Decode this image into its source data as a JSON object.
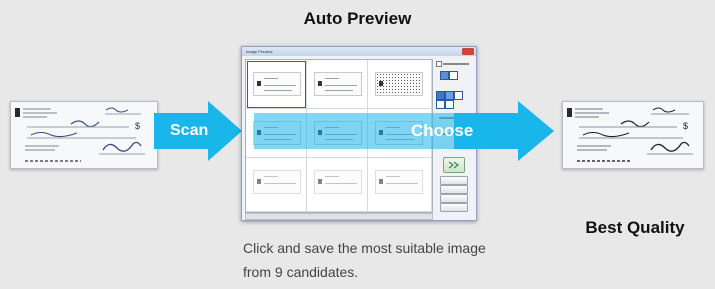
{
  "titles": {
    "auto_preview": "Auto Preview",
    "best_quality": "Best Quality"
  },
  "arrows": {
    "scan": "Scan",
    "choose": "Choose"
  },
  "caption": "Click and save the most suitable image from 9 candidates.",
  "window": {
    "title": "Image Preview",
    "candidates": 9,
    "selected_index": 0
  },
  "colors": {
    "arrow_cyan": "#19b6ea",
    "selection_red": "#e02020",
    "background": "#e8e8e8"
  }
}
